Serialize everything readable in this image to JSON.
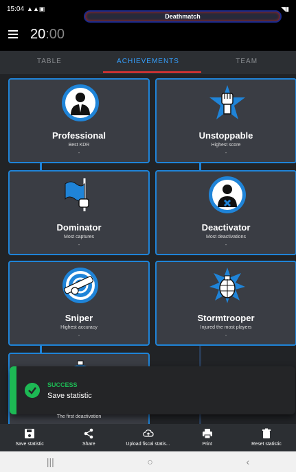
{
  "status_bar": {
    "time": "15:04"
  },
  "header": {
    "timer_main": "20",
    "timer_dim": ":00",
    "mode": "Deathmatch"
  },
  "tabs": [
    {
      "label": "TABLE",
      "active": false
    },
    {
      "label": "ACHIEVEMENTS",
      "active": true
    },
    {
      "label": "TEAM",
      "active": false
    }
  ],
  "achievements": [
    {
      "title": "Professional",
      "subtitle": "Best KDR",
      "value": "-",
      "icon": "businessman-icon"
    },
    {
      "title": "Unstoppable",
      "subtitle": "Highest score",
      "value": "-",
      "icon": "raised-fist-icon"
    },
    {
      "title": "Dominator",
      "subtitle": "Most captures",
      "value": "-",
      "icon": "flag-icon"
    },
    {
      "title": "Deactivator",
      "subtitle": "Most deactivations",
      "value": "-",
      "icon": "defuser-icon"
    },
    {
      "title": "Sniper",
      "subtitle": "Highest accuracy",
      "value": "-",
      "icon": "crosshair-icon"
    },
    {
      "title": "Stormtrooper",
      "subtitle": "Injured the most players",
      "value": "-",
      "icon": "grenade-icon"
    },
    {
      "subtitle": "The first deactivation",
      "icon": "stopwatch-icon"
    }
  ],
  "toast": {
    "heading": "SUCCESS",
    "message": "Save statistic",
    "color": "#1db954"
  },
  "bottom_nav": [
    {
      "label": "Save statistic",
      "icon": "save-icon"
    },
    {
      "label": "Share",
      "icon": "share-icon"
    },
    {
      "label": "Upload fiscal statis...",
      "icon": "cloud-upload-icon"
    },
    {
      "label": "Print",
      "icon": "print-icon"
    },
    {
      "label": "Reset statistic",
      "icon": "trash-icon"
    }
  ],
  "colors": {
    "accent": "#1f84d8",
    "active_tab": "#35a0ff",
    "tab_underline": "#e33333"
  }
}
